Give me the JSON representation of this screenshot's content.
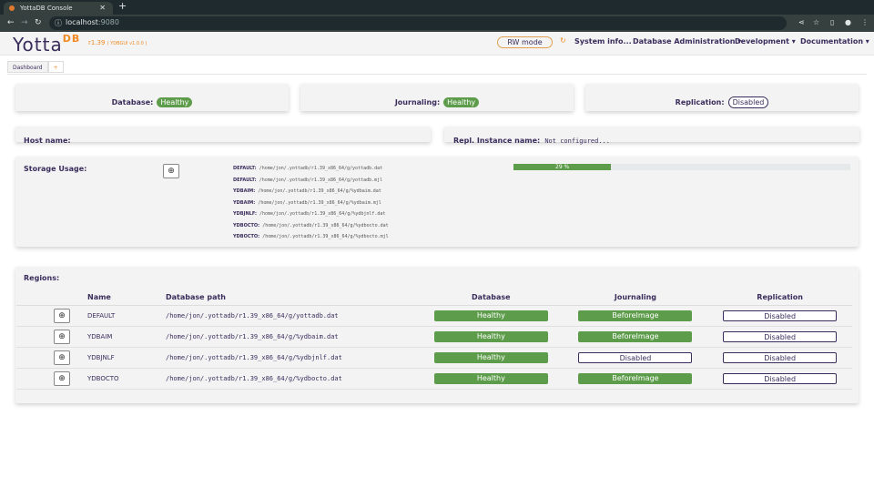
{
  "browser": {
    "tab_title": "YottaDB Console",
    "url_host": "localhost",
    "url_port": ":9080"
  },
  "header": {
    "logo": "Yotta",
    "logo_sup": "DB",
    "version": "r1.39",
    "gui_version": "( YDBGUI v1.0.0 )",
    "rw_mode": "RW mode",
    "menu": [
      "System info...",
      "Database Administration ▾",
      "Development ▾",
      "Documentation ▾"
    ]
  },
  "tabs": {
    "dashboard": "Dashboard",
    "add": "+"
  },
  "status": {
    "database_label": "Database:",
    "database_value": "Healthy",
    "journaling_label": "Journaling:",
    "journaling_value": "Healthy",
    "replication_label": "Replication:",
    "replication_value": "Disabled"
  },
  "host": {
    "label": "Host name:",
    "value": "",
    "repl_label": "Repl. Instance name:",
    "repl_value": "Not configured..."
  },
  "storage": {
    "label": "Storage Usage:",
    "usage_percent": 29,
    "usage_text": "29 %",
    "files": [
      {
        "region": "DEFAULT:",
        "path": "/home/jon/.yottadb/r1.39_x86_64/g/yottadb.dat"
      },
      {
        "region": "DEFAULT:",
        "path": "/home/jon/.yottadb/r1.39_x86_64/g/yottadb.mjl"
      },
      {
        "region": "YDBAIM:",
        "path": "/home/jon/.yottadb/r1.39_x86_64/g/%ydbaim.dat"
      },
      {
        "region": "YDBAIM:",
        "path": "/home/jon/.yottadb/r1.39_x86_64/g/%ydbaim.mjl"
      },
      {
        "region": "YDBJNLF:",
        "path": "/home/jon/.yottadb/r1.39_x86_64/g/%ydbjnlf.dat"
      },
      {
        "region": "YDBOCTO:",
        "path": "/home/jon/.yottadb/r1.39_x86_64/g/%ydbocto.dat"
      },
      {
        "region": "YDBOCTO:",
        "path": "/home/jon/.yottadb/r1.39_x86_64/g/%ydbocto.mjl"
      }
    ]
  },
  "regions": {
    "label": "Regions:",
    "columns": [
      "Name",
      "Database path",
      "Database",
      "Journaling",
      "Replication"
    ],
    "rows": [
      {
        "name": "DEFAULT",
        "path": "/home/jon/.yottadb/r1.39_x86_64/g/yottadb.dat",
        "database": "Healthy",
        "journaling": "BeforeImage",
        "replication": "Disabled"
      },
      {
        "name": "YDBAIM",
        "path": "/home/jon/.yottadb/r1.39_x86_64/g/%ydbaim.dat",
        "database": "Healthy",
        "journaling": "BeforeImage",
        "replication": "Disabled"
      },
      {
        "name": "YDBJNLF",
        "path": "/home/jon/.yottadb/r1.39_x86_64/g/%ydbjnlf.dat",
        "database": "Healthy",
        "journaling": "Disabled",
        "replication": "Disabled"
      },
      {
        "name": "YDBOCTO",
        "path": "/home/jon/.yottadb/r1.39_x86_64/g/%ydbocto.dat",
        "database": "Healthy",
        "journaling": "BeforeImage",
        "replication": "Disabled"
      }
    ]
  }
}
